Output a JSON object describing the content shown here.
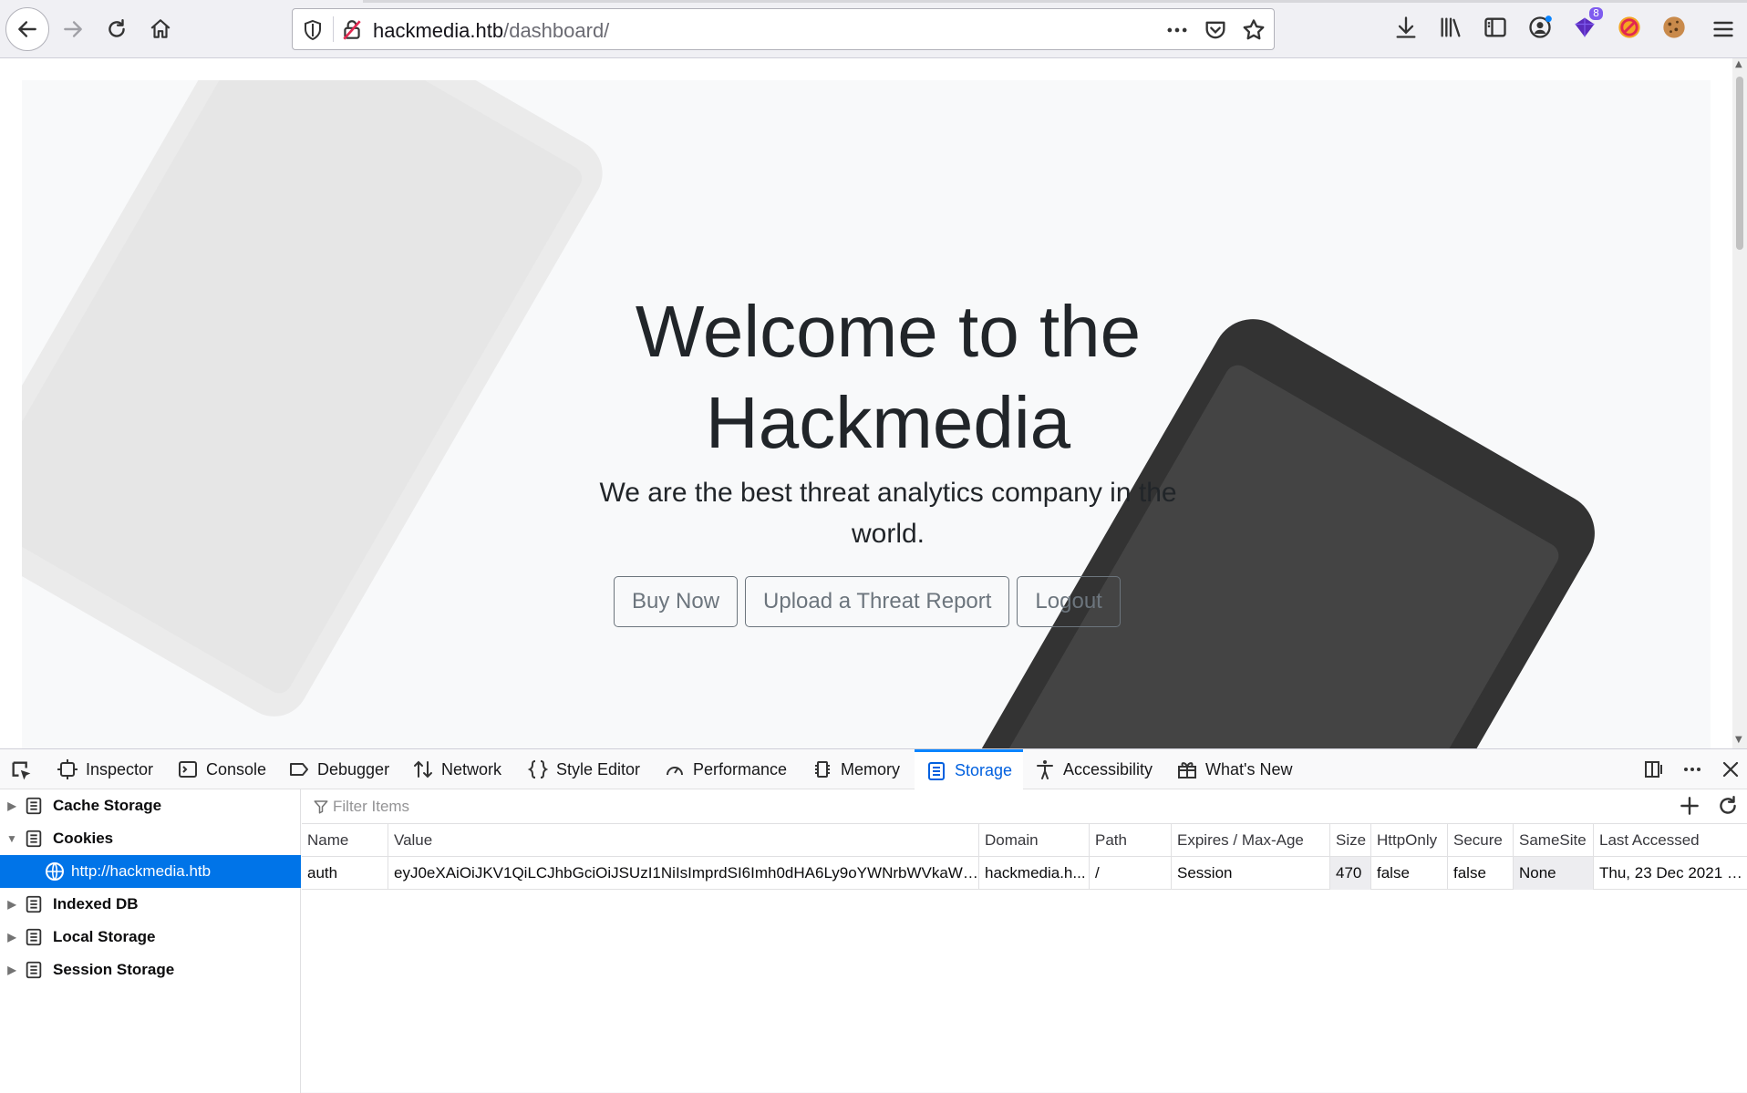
{
  "browser": {
    "url_host": "hackmedia.htb",
    "url_path": "/dashboard/",
    "extension_badge": "8"
  },
  "page": {
    "title": "Welcome to the Hackmedia",
    "subtitle": "We are the best threat analytics company in the world.",
    "buttons": {
      "buy": "Buy Now",
      "upload": "Upload a Threat Report",
      "logout": "Logout"
    }
  },
  "devtools": {
    "tabs": {
      "inspector": "Inspector",
      "console": "Console",
      "debugger": "Debugger",
      "network": "Network",
      "style_editor": "Style Editor",
      "performance": "Performance",
      "memory": "Memory",
      "storage": "Storage",
      "accessibility": "Accessibility",
      "whats_new": "What's New"
    },
    "active_tab": "Storage",
    "sidebar": {
      "cache_storage": "Cache Storage",
      "cookies": "Cookies",
      "cookies_host": "http://hackmedia.htb",
      "indexed_db": "Indexed DB",
      "local_storage": "Local Storage",
      "session_storage": "Session Storage"
    },
    "filter_placeholder": "Filter Items",
    "columns": {
      "name": "Name",
      "value": "Value",
      "domain": "Domain",
      "path": "Path",
      "expires": "Expires / Max-Age",
      "size": "Size",
      "httponly": "HttpOnly",
      "secure": "Secure",
      "samesite": "SameSite",
      "last_accessed": "Last Accessed"
    },
    "cookie": {
      "name": "auth",
      "value": "eyJ0eXAiOiJKV1QiLCJhbGciOiJSUzI1NiIsImprdSI6Imh0dHA6Ly9oYWNrbWVkaWE...",
      "domain": "hackmedia.h...",
      "path": "/",
      "expires": "Session",
      "size": "470",
      "httponly": "false",
      "secure": "false",
      "samesite": "None",
      "last_accessed": "Thu, 23 Dec 2021 01..."
    }
  },
  "colors": {
    "accent": "#0060df",
    "selection": "#0074e8",
    "phone": "#333333",
    "button_outline": "#6c757d"
  }
}
